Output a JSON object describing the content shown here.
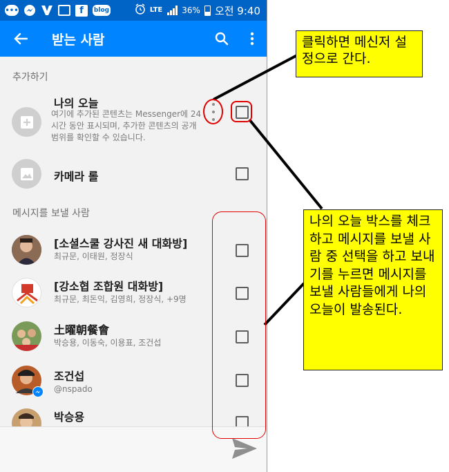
{
  "status_bar": {
    "left_icons": [
      "chat-bubble-icon",
      "messenger-icon",
      "v-app-icon",
      "note-icon",
      "facebook-icon",
      "blog-icon"
    ],
    "blog_label": "blog",
    "fb_label": "f",
    "lte_label": "LTE",
    "battery": "36%",
    "time": "오전 9:40"
  },
  "app_bar": {
    "title": "받는 사람",
    "back_icon": "arrow-left-icon",
    "search_icon": "search-icon",
    "more_icon": "more-vertical-icon"
  },
  "sections": {
    "add": "추가하기",
    "send_to": "메시지를 보낼 사람"
  },
  "story": {
    "title": "나의 오늘",
    "description": "여기에 추가된 콘텐츠는 Messenger에 24시간 동안 표시되며, 추가한 콘텐츠의 공개 범위를 확인할 수 있습니다."
  },
  "camera_roll": {
    "title": "카메라 롤"
  },
  "recipients": [
    {
      "name": "[소셜스쿨 강사진 새 대화방]",
      "sub": "최규문, 이태원, 정장식"
    },
    {
      "name": "[강소협 조합원 대화방]",
      "sub": "최규문, 최돈익, 김영희, 정장식, +9명"
    },
    {
      "name": "土曜朝餐會",
      "sub": "박승용, 이동숙, 이용표, 조건섭"
    },
    {
      "name": "조건섭",
      "sub": "@nspado"
    },
    {
      "name": "박승용",
      "sub": ""
    }
  ],
  "annotations": {
    "top": "클릭하면 메신저 설정으로 간다.",
    "bottom": "나의 오늘 박스를 체크하고 메시지를 보낼 사람 중 선택을 하고 보내기를 누르면 메시지를 보낼 사람들에게 나의 오늘이 발송된다."
  },
  "colors": {
    "status_bar": "#0064c6",
    "app_bar": "#0084ff",
    "annotation_fill": "#ffff00",
    "annotation_ring": "#e00000"
  }
}
